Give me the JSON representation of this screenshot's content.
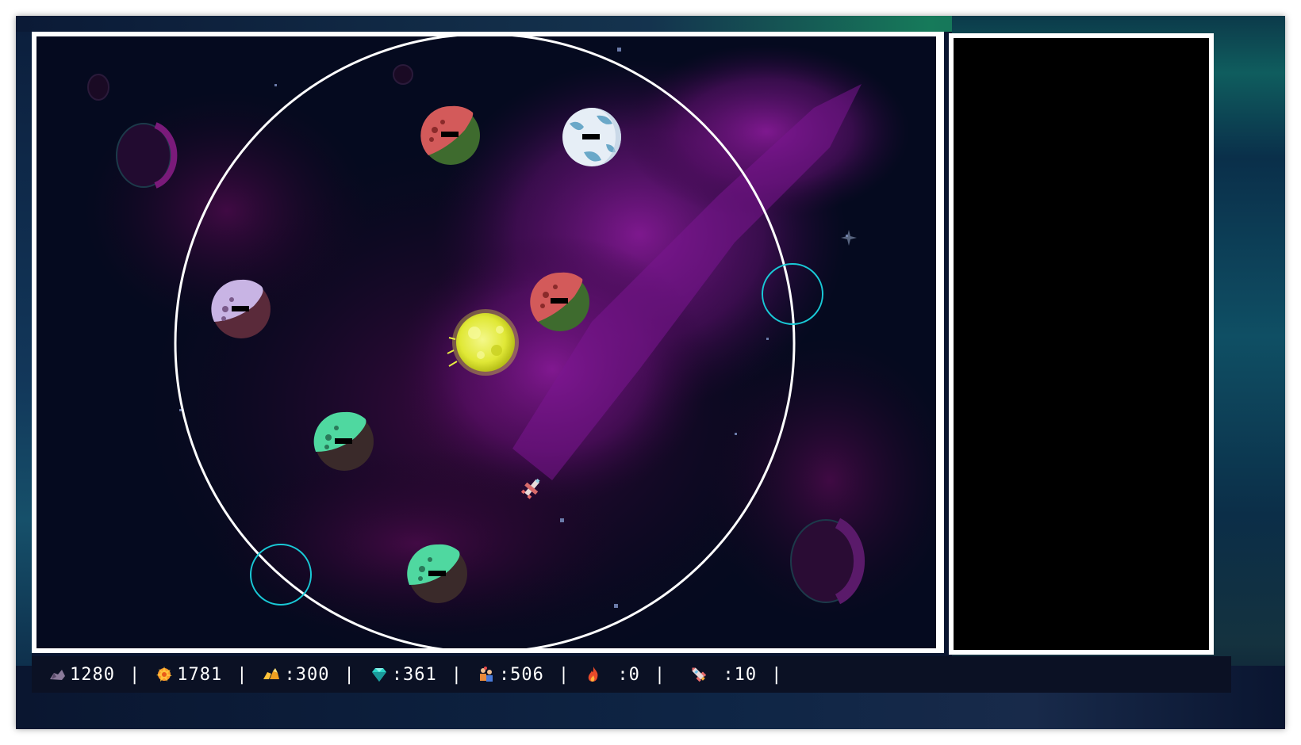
{
  "colors": {
    "space": "#050a1f",
    "orbit_ring": "#ffffff",
    "warp_ring": "#19c9d6",
    "sun": "#e4ec3a",
    "planet_red": "#d35a5a",
    "planet_red_shade": "#3e6b2e",
    "planet_green": "#4fd8a0",
    "planet_green_shade": "#3a2a2a",
    "planet_lilac": "#c8b4e4",
    "planet_lilac_shade": "#5a2a3a",
    "planet_ice": "#e6eef6",
    "planet_ice_shade": "#6aa8c8"
  },
  "scene": {
    "sun": {
      "name": "sun"
    },
    "planets": [
      {
        "name": "planet-red-top",
        "type": "red"
      },
      {
        "name": "planet-ice",
        "type": "ice"
      },
      {
        "name": "planet-lilac",
        "type": "lilac"
      },
      {
        "name": "planet-red-center",
        "type": "red"
      },
      {
        "name": "planet-green-left",
        "type": "green"
      },
      {
        "name": "planet-green-bottom",
        "type": "green"
      }
    ],
    "warp_points": [
      {
        "name": "warp-point-right"
      },
      {
        "name": "warp-point-bottom-left"
      }
    ],
    "ship": {
      "name": "player-ship"
    }
  },
  "resources": [
    {
      "icon": "ore-icon",
      "label": "1280",
      "color": "#8a7a9a"
    },
    {
      "icon": "energy-icon",
      "label": "1781",
      "color": "#ff9a2a"
    },
    {
      "icon": "gold-icon",
      "label": ":300",
      "color": "#ffc23a"
    },
    {
      "icon": "crystal-icon",
      "label": ":361",
      "color": "#2ad6c8"
    },
    {
      "icon": "crew-icon",
      "label": ":506",
      "color": "#e88a3a"
    },
    {
      "icon": "fire-icon",
      "label": " :0",
      "color": "#e84a2a"
    },
    {
      "icon": "rocket-icon",
      "label": " :10",
      "color": "#e86a6a"
    }
  ]
}
